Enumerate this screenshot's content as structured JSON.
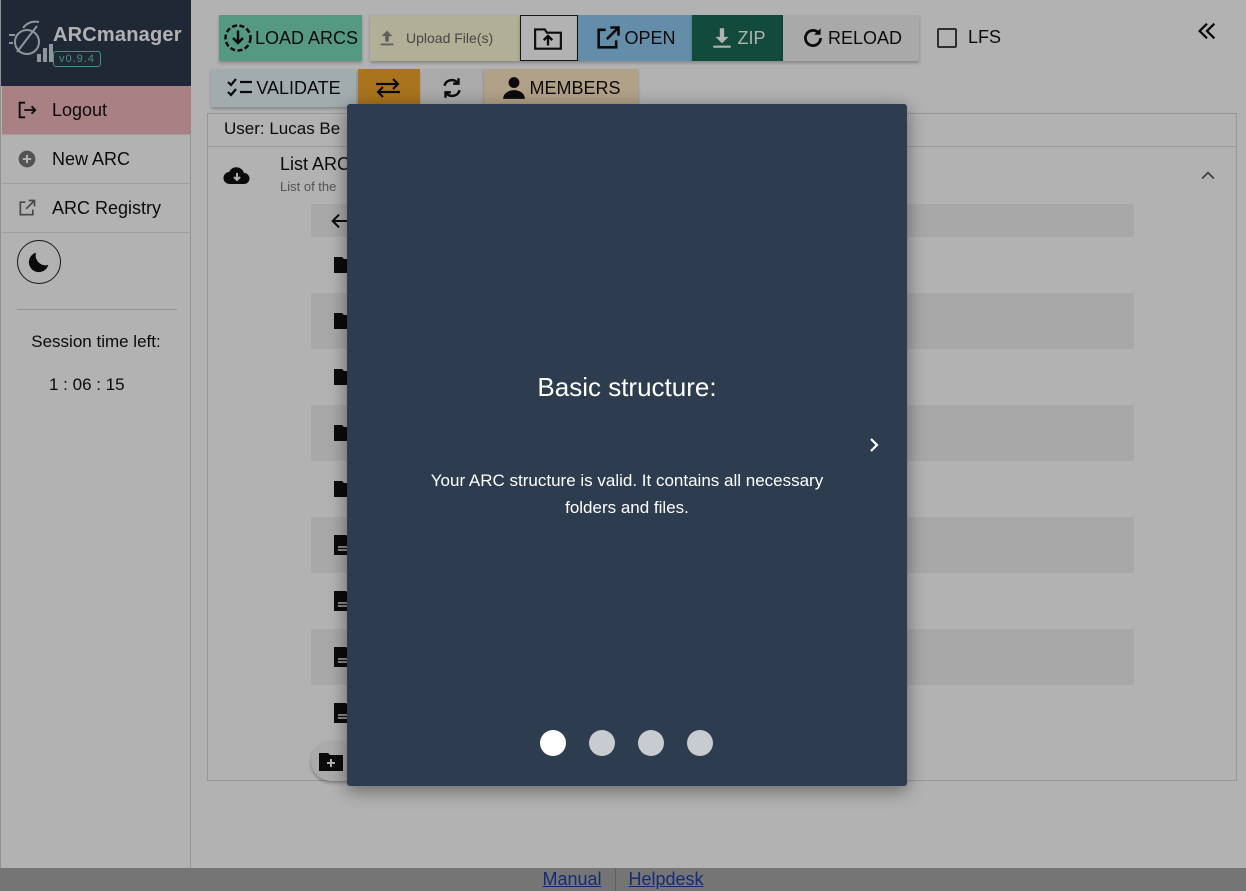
{
  "app": {
    "brand_name": "ARCmanager",
    "version": "v0.9.4"
  },
  "sidebar": {
    "items": [
      {
        "label": "Logout",
        "icon": "logout-icon"
      },
      {
        "label": "New ARC",
        "icon": "plus-circle-icon"
      },
      {
        "label": "ARC Registry",
        "icon": "external-link-icon"
      }
    ],
    "theme_toggle_icon": "moon-icon",
    "session_label": "Session time left:",
    "session_time": "1 : 06 : 15"
  },
  "toolbar": {
    "load_arcs": "LOAD ARCS",
    "upload_placeholder": "Upload File(s)",
    "open": "OPEN",
    "zip": "ZIP",
    "reload": "RELOAD",
    "lfs_label": "LFS",
    "lfs_checked": false,
    "validate": "VALIDATE",
    "members": "MEMBERS"
  },
  "main": {
    "user_text": "User: Lucas Be",
    "list_title": "List ARC",
    "list_subtitle": "List of the"
  },
  "modal": {
    "title": "Basic structure:",
    "message": "Your ARC structure is valid. It contains all necessary folders and files.",
    "pages": 4,
    "active_page": 1
  },
  "footer": {
    "links": [
      "Manual",
      "Helpdesk"
    ]
  },
  "colors": {
    "brand_bg": "#2d3a4b",
    "logout_bg": "#f2b8be",
    "load_bg": "#7bdcbc",
    "open_bg": "#8ecbf3",
    "zip_bg": "#1a6b57",
    "swap_bg": "#f3a72a",
    "members_bg": "#ffe7c4",
    "modal_bg": "#2e3c50"
  }
}
